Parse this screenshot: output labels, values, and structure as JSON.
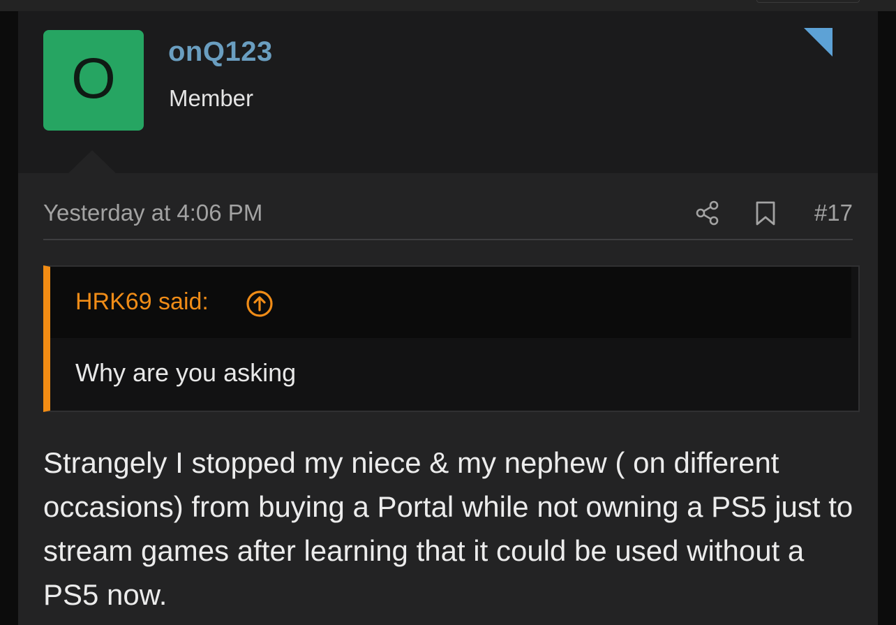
{
  "post": {
    "author": {
      "avatar_letter": "O",
      "avatar_color": "#26a562",
      "username": "onQ123",
      "title": "Member"
    },
    "corner_flag_color": "#5da2d6",
    "meta": {
      "timestamp": "Yesterday at 4:06 PM",
      "share_icon": "share-icon",
      "bookmark_icon": "bookmark-icon",
      "post_number": "#17"
    },
    "quote": {
      "author_label": "HRK69 said:",
      "jump_icon": "arrow-up-circle-icon",
      "accent_color": "#f28c14",
      "text": "Why are you asking"
    },
    "body": "Strangely I stopped my niece & my nephew ( on different occasions) from buying a Portal while not owning a PS5 just to stream games after learning that it could be used without a PS5 now."
  }
}
